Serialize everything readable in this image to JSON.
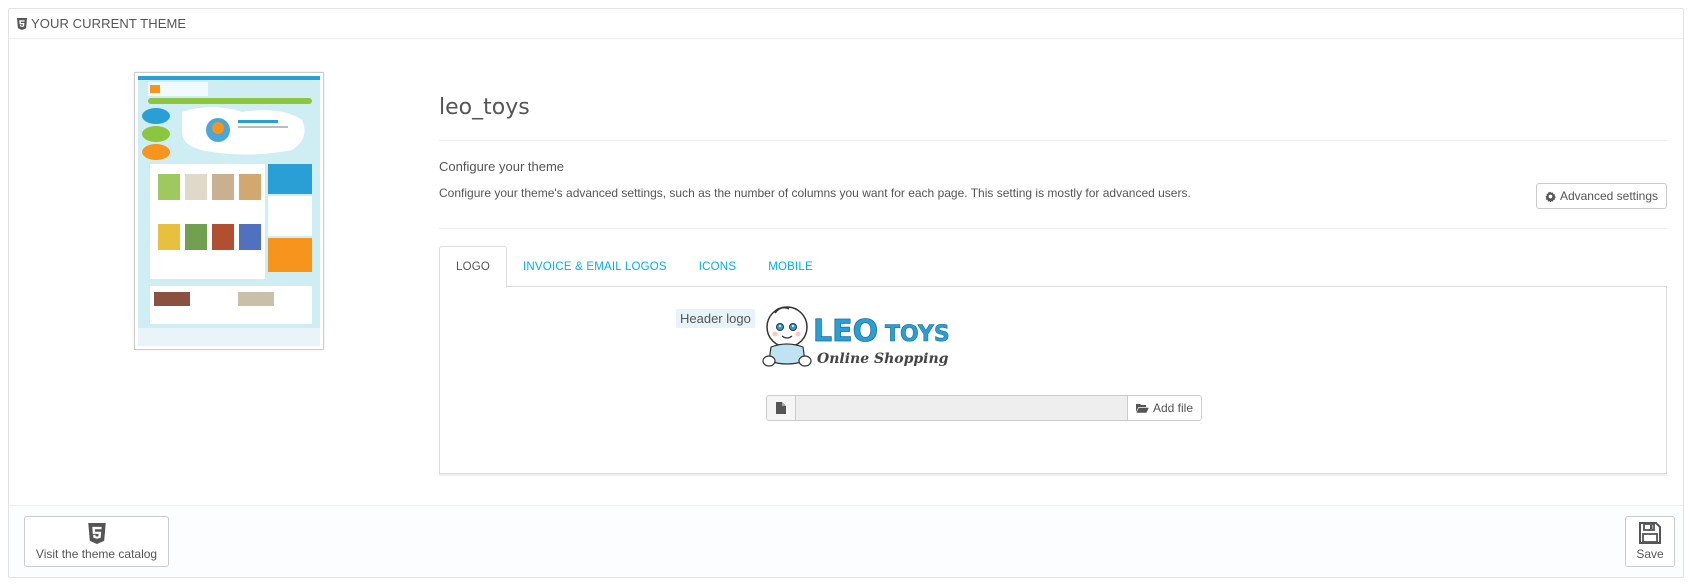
{
  "panel": {
    "heading": "YOUR CURRENT THEME",
    "heading_icon": "html5-icon"
  },
  "theme": {
    "name": "leo_toys",
    "configure_title": "Configure your theme",
    "configure_desc": "Configure your theme's advanced settings, such as the number of columns you want for each page. This setting is mostly for advanced users.",
    "advanced_label": "Advanced settings"
  },
  "tabs": [
    {
      "label": "LOGO",
      "active": true
    },
    {
      "label": "INVOICE & EMAIL LOGOS",
      "active": false
    },
    {
      "label": "ICONS",
      "active": false
    },
    {
      "label": "MOBILE",
      "active": false
    }
  ],
  "logo_tab": {
    "header_logo_label": "Header logo",
    "logo_text_main": "LEO",
    "logo_text_toys": "TOYS",
    "logo_tagline": "Online Shopping",
    "file_value": "",
    "add_file_label": "Add file"
  },
  "footer": {
    "catalog_label": "Visit the theme catalog",
    "save_label": "Save"
  },
  "colors": {
    "accent": "#00aff0",
    "logo_blue": "#2a9fd6",
    "logo_orange": "#f7941d"
  }
}
